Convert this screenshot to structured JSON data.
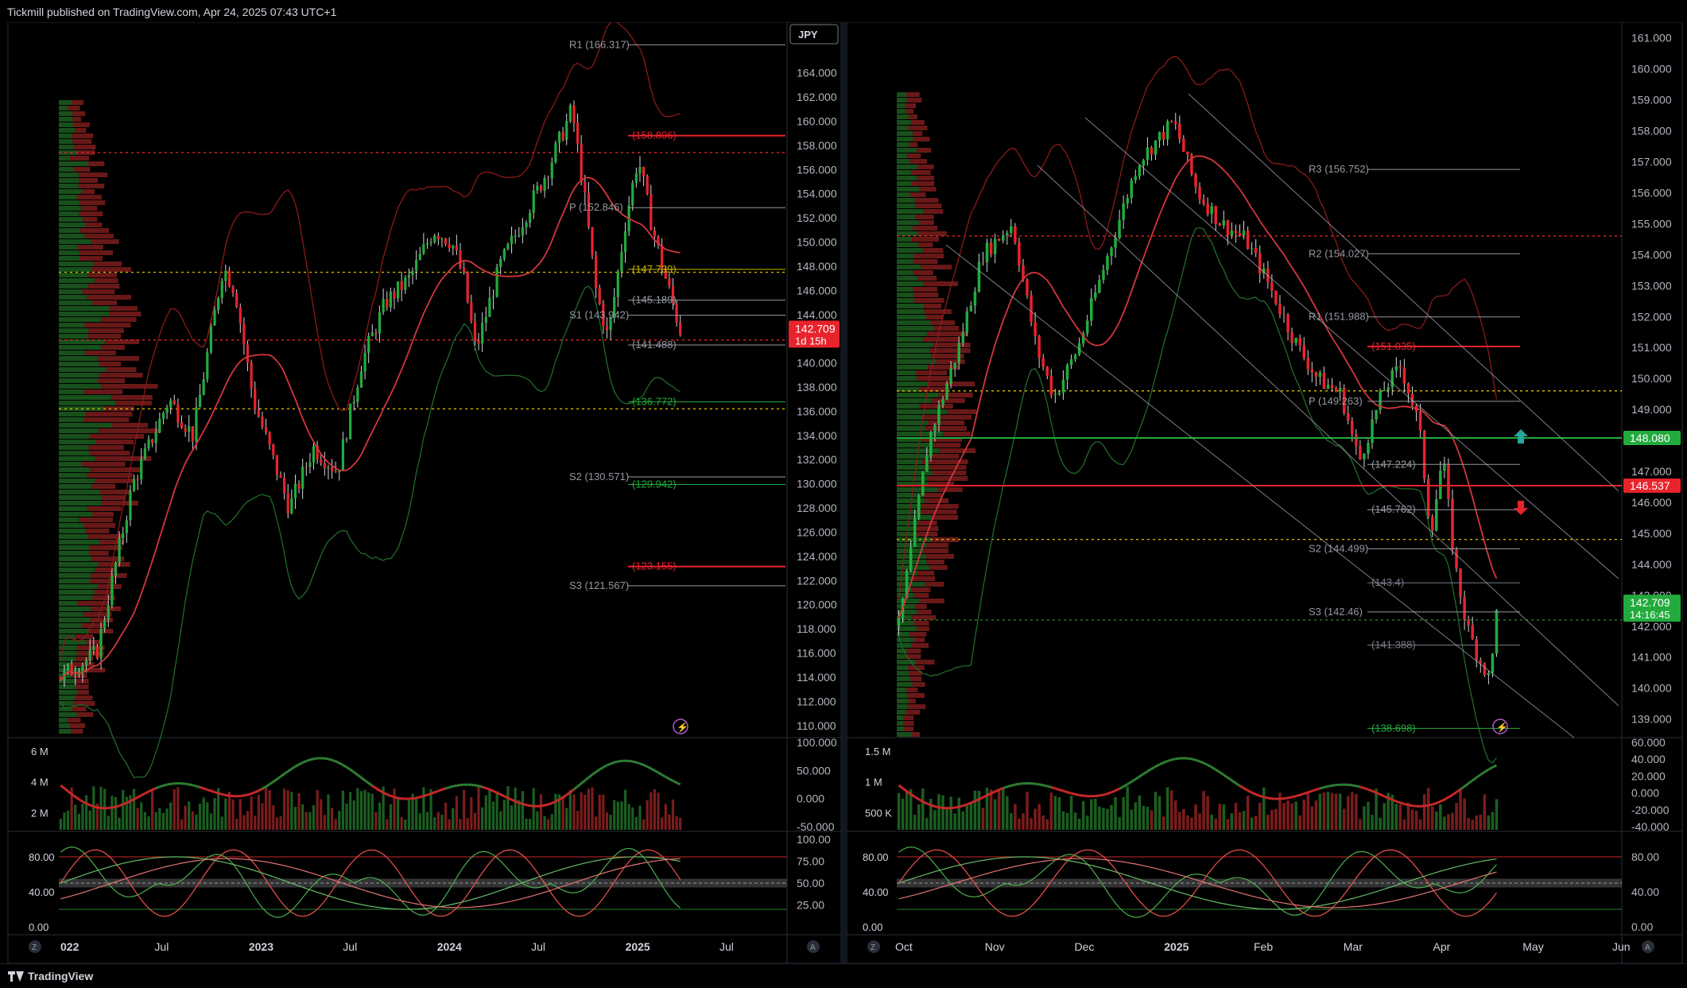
{
  "header": {
    "text": "Tickmill published on TradingView.com, Apr 24, 2025 07:43 UTC+1"
  },
  "footer": {
    "brand": "TradingView"
  },
  "colors": {
    "background": "#000000",
    "up": "#22ab3c",
    "down": "#e8232c",
    "axis_text": "#b2b5be",
    "grid": "#1e222d"
  },
  "icons": [
    "z-axis-icon",
    "a-axis-icon",
    "lightning-icon",
    "arrow-up-icon",
    "arrow-down-icon",
    "tradingview-logo-icon"
  ],
  "chart_data": [
    {
      "type": "candlestick",
      "panel": "left",
      "currency": "JPY",
      "price_ticks": [
        "164.000",
        "162.000",
        "160.000",
        "158.000",
        "156.000",
        "154.000",
        "152.000",
        "150.000",
        "148.000",
        "146.000",
        "144.000",
        "142.000",
        "140.000",
        "138.000",
        "136.000",
        "134.000",
        "132.000",
        "130.000",
        "128.000",
        "126.000",
        "124.000",
        "122.000",
        "120.000",
        "118.000",
        "116.000",
        "114.000",
        "112.000",
        "110.000"
      ],
      "ylim": [
        109,
        167
      ],
      "time_ticks": [
        "022",
        "Jul",
        "2023",
        "Jul",
        "2024",
        "Jul",
        "2025",
        "Jul"
      ],
      "last_price": {
        "value": "142.709",
        "countdown": "1d 15h"
      },
      "path": [
        {
          "t": 0,
          "v": 114
        },
        {
          "t": 0.06,
          "v": 116
        },
        {
          "t": 0.12,
          "v": 130
        },
        {
          "t": 0.18,
          "v": 137
        },
        {
          "t": 0.22,
          "v": 134
        },
        {
          "t": 0.27,
          "v": 148
        },
        {
          "t": 0.29,
          "v": 146
        },
        {
          "t": 0.32,
          "v": 137
        },
        {
          "t": 0.36,
          "v": 131
        },
        {
          "t": 0.38,
          "v": 128
        },
        {
          "t": 0.42,
          "v": 133
        },
        {
          "t": 0.46,
          "v": 131
        },
        {
          "t": 0.5,
          "v": 140
        },
        {
          "t": 0.54,
          "v": 145
        },
        {
          "t": 0.58,
          "v": 147
        },
        {
          "t": 0.62,
          "v": 151
        },
        {
          "t": 0.65,
          "v": 150
        },
        {
          "t": 0.67,
          "v": 147
        },
        {
          "t": 0.69,
          "v": 141
        },
        {
          "t": 0.73,
          "v": 148
        },
        {
          "t": 0.77,
          "v": 152
        },
        {
          "t": 0.81,
          "v": 156
        },
        {
          "t": 0.85,
          "v": 161
        },
        {
          "t": 0.87,
          "v": 154
        },
        {
          "t": 0.89,
          "v": 146
        },
        {
          "t": 0.91,
          "v": 142
        },
        {
          "t": 0.94,
          "v": 152
        },
        {
          "t": 0.96,
          "v": 157
        },
        {
          "t": 0.98,
          "v": 152
        },
        {
          "t": 1.0,
          "v": 148
        },
        {
          "t": 1.03,
          "v": 142.7
        }
      ],
      "levels": [
        {
          "label": "R1 (166.317)",
          "value": 166.317,
          "color": "#9598a1"
        },
        {
          "label": "(158.806)",
          "value": 158.806,
          "color": "#e8232c"
        },
        {
          "label": "P (152.846)",
          "value": 152.846,
          "color": "#9598a1"
        },
        {
          "label": "(147.739)",
          "value": 147.739,
          "color": "#c9b400"
        },
        {
          "label": "(145.189)",
          "value": 145.189,
          "color": "#9598a1"
        },
        {
          "label": "S1 (143.942)",
          "value": 143.942,
          "color": "#9598a1"
        },
        {
          "label": "(141.488)",
          "value": 141.488,
          "color": "#9598a1"
        },
        {
          "label": "(136.772)",
          "value": 136.772,
          "color": "#22ab3c"
        },
        {
          "label": "S2 (130.571)",
          "value": 130.571,
          "color": "#9598a1"
        },
        {
          "label": "(129.942)",
          "value": 129.942,
          "color": "#22ab3c"
        },
        {
          "label": "(123.155)",
          "value": 123.155,
          "color": "#e8232c"
        },
        {
          "label": "S3 (121.567)",
          "value": 121.567,
          "color": "#9598a1"
        }
      ],
      "volume_ticks": [
        "6 M",
        "4 M",
        "2 M"
      ],
      "osc1_ticks": [
        "100.000",
        "50.000",
        "0.000",
        "-50.000"
      ],
      "osc2_left_ticks": [
        "80.00",
        "40.00",
        "0.00"
      ],
      "osc2_right_ticks": [
        "100.00",
        "75.00",
        "50.00",
        "25.00"
      ]
    },
    {
      "type": "candlestick",
      "panel": "right",
      "price_ticks": [
        "161.000",
        "160.000",
        "159.000",
        "158.000",
        "157.000",
        "156.000",
        "155.000",
        "154.000",
        "153.000",
        "152.000",
        "151.000",
        "150.000",
        "149.000",
        "148.000",
        "147.000",
        "146.000",
        "145.000",
        "144.000",
        "143.000",
        "142.000",
        "141.000",
        "140.000",
        "139.000"
      ],
      "ylim": [
        138.4,
        161.3
      ],
      "time_ticks": [
        "Oct",
        "Nov",
        "Dec",
        "2025",
        "Feb",
        "Mar",
        "Apr",
        "May",
        "Jun"
      ],
      "last_price": {
        "value": "142.709",
        "countdown": "14:16:45"
      },
      "marked_prices": [
        {
          "value": "148.080",
          "color": "#22ab3c"
        },
        {
          "value": "146.537",
          "color": "#e8232c"
        }
      ],
      "path": [
        {
          "t": 0,
          "v": 142
        },
        {
          "t": 0.05,
          "v": 148
        },
        {
          "t": 0.1,
          "v": 151
        },
        {
          "t": 0.14,
          "v": 154
        },
        {
          "t": 0.19,
          "v": 155
        },
        {
          "t": 0.23,
          "v": 151
        },
        {
          "t": 0.26,
          "v": 149.4
        },
        {
          "t": 0.3,
          "v": 151
        },
        {
          "t": 0.35,
          "v": 154
        },
        {
          "t": 0.4,
          "v": 157
        },
        {
          "t": 0.46,
          "v": 158.3
        },
        {
          "t": 0.5,
          "v": 156
        },
        {
          "t": 0.54,
          "v": 155
        },
        {
          "t": 0.58,
          "v": 154.5
        },
        {
          "t": 0.62,
          "v": 153
        },
        {
          "t": 0.66,
          "v": 151.3
        },
        {
          "t": 0.7,
          "v": 150
        },
        {
          "t": 0.74,
          "v": 149.5
        },
        {
          "t": 0.77,
          "v": 147.3
        },
        {
          "t": 0.81,
          "v": 149.6
        },
        {
          "t": 0.84,
          "v": 150.4
        },
        {
          "t": 0.87,
          "v": 148.5
        },
        {
          "t": 0.89,
          "v": 145
        },
        {
          "t": 0.91,
          "v": 147.5
        },
        {
          "t": 0.93,
          "v": 144
        },
        {
          "t": 0.95,
          "v": 142
        },
        {
          "t": 0.97,
          "v": 141
        },
        {
          "t": 0.99,
          "v": 140.2
        },
        {
          "t": 1.0,
          "v": 142.7
        }
      ],
      "levels": [
        {
          "label": "R3 (156.752)",
          "value": 156.752,
          "color": "#9598a1"
        },
        {
          "label": "R2 (154.027)",
          "value": 154.027,
          "color": "#9598a1"
        },
        {
          "label": "R1 (151.988)",
          "value": 151.988,
          "color": "#9598a1"
        },
        {
          "label": "(151.035)",
          "value": 151.035,
          "color": "#e8232c"
        },
        {
          "label": "P (149.263)",
          "value": 149.263,
          "color": "#9598a1"
        },
        {
          "label": "(147.224)",
          "value": 147.224,
          "color": "#9598a1"
        },
        {
          "label": "(145.762)",
          "value": 145.762,
          "color": "#9598a1"
        },
        {
          "label": "S2 (144.499)",
          "value": 144.499,
          "color": "#9598a1"
        },
        {
          "label": "(143.4)",
          "value": 143.4,
          "color": "#787b86"
        },
        {
          "label": "S3 (142.46)",
          "value": 142.46,
          "color": "#9598a1"
        },
        {
          "label": "(141.388)",
          "value": 141.388,
          "color": "#787b86"
        },
        {
          "label": "(138.698)",
          "value": 138.698,
          "color": "#22ab3c"
        }
      ],
      "volume_ticks": [
        "1.5 M",
        "1 M",
        "500 K"
      ],
      "osc1_ticks": [
        "60.000",
        "40.000",
        "20.000",
        "0.000",
        "-20.000",
        "-40.000"
      ],
      "osc2_left_ticks": [
        "80.00",
        "40.00",
        "0.00"
      ],
      "osc2_right_ticks": [
        "80.00",
        "40.00",
        "0.00"
      ]
    }
  ]
}
